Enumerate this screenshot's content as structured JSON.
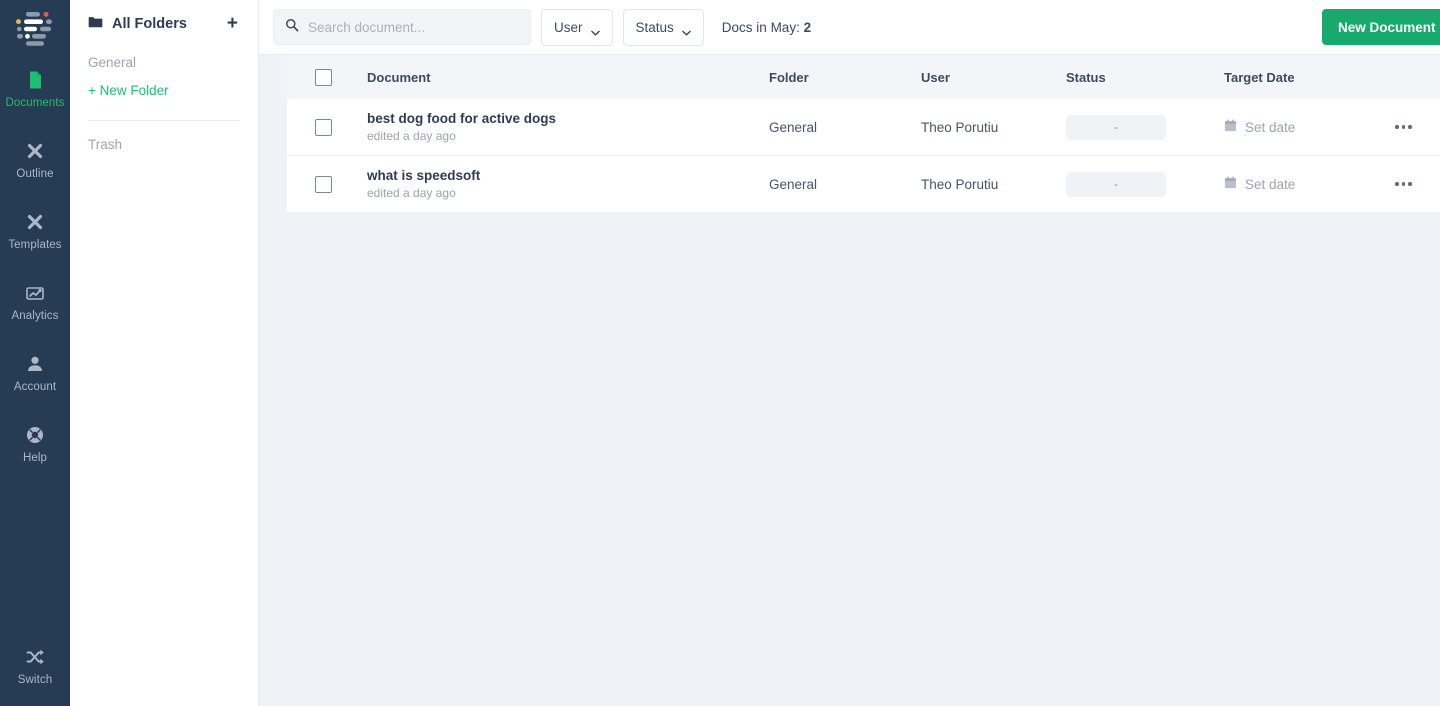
{
  "rail": {
    "logo_name": "app-logo",
    "items": [
      {
        "label": "Documents",
        "icon": "document-icon",
        "active": true
      },
      {
        "label": "Outline",
        "icon": "magic-wand-icon",
        "active": false
      },
      {
        "label": "Templates",
        "icon": "magic-wand-icon",
        "active": false
      },
      {
        "label": "Analytics",
        "icon": "chart-line-icon",
        "active": false
      },
      {
        "label": "Account",
        "icon": "user-icon",
        "active": false
      },
      {
        "label": "Help",
        "icon": "lifebuoy-icon",
        "active": false
      }
    ],
    "bottom": {
      "label": "Switch",
      "icon": "shuffle-icon"
    },
    "active_color": "#1dbf73",
    "background": "#263b54"
  },
  "folders": {
    "title": "All Folders",
    "folder_icon": "folder-icon",
    "add_icon": "plus-icon",
    "items": [
      {
        "label": "General"
      }
    ],
    "new_folder_label": "+ New Folder",
    "trash_label": "Trash"
  },
  "toolbar": {
    "search": {
      "placeholder": "Search document...",
      "value": "",
      "icon": "search-icon"
    },
    "user_filter": {
      "label": "User",
      "icon": "chevron-down-icon"
    },
    "status_filter": {
      "label": "Status",
      "icon": "chevron-down-icon"
    },
    "docs_count_label": "Docs in May:",
    "docs_count_value": "2",
    "new_document_label": "New Document",
    "accent_color": "#18a96f"
  },
  "table": {
    "headers": {
      "document": "Document",
      "folder": "Folder",
      "user": "User",
      "status": "Status",
      "target_date": "Target Date"
    },
    "select_all_name": "select-all-checkbox",
    "rows": [
      {
        "title": "best dog food for active dogs",
        "subtitle": "edited a day ago",
        "folder": "General",
        "user": "Theo Porutiu",
        "status": "-",
        "target_date": "Set date",
        "date_icon": "calendar-icon",
        "more_icon": "more-horizontal-icon"
      },
      {
        "title": "what is speedsoft",
        "subtitle": "edited a day ago",
        "folder": "General",
        "user": "Theo Porutiu",
        "status": "-",
        "target_date": "Set date",
        "date_icon": "calendar-icon",
        "more_icon": "more-horizontal-icon"
      }
    ]
  }
}
